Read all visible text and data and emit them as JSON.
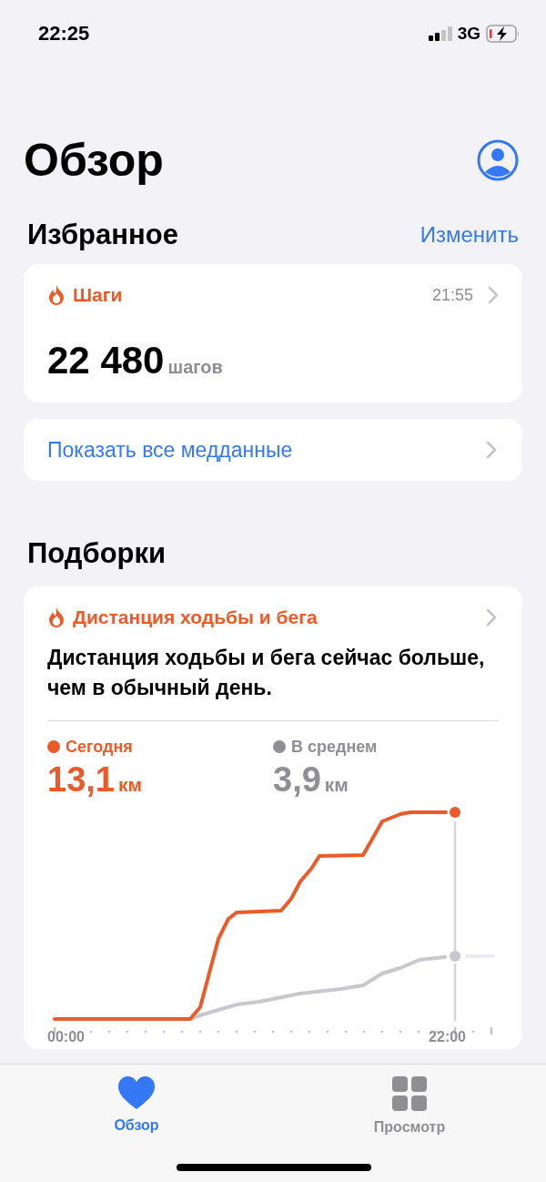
{
  "status_bar": {
    "time": "22:25",
    "network": "3G"
  },
  "header": {
    "title": "Обзор"
  },
  "favorites": {
    "title": "Избранное",
    "edit": "Изменить",
    "cards": [
      {
        "title": "Шаги",
        "time": "21:55",
        "value": "22 480",
        "unit": "шагов"
      }
    ],
    "show_all": "Показать все медданные"
  },
  "highlights": {
    "title": "Подборки",
    "cards": [
      {
        "title": "Дистанция ходьбы и бега",
        "text": "Дистанция ходьбы и бега сейчас больше, чем в обычный день.",
        "legend": [
          {
            "label": "Сегодня",
            "value": "13,1",
            "unit": "км",
            "color": "#eb5b2a"
          },
          {
            "label": "В среднем",
            "value": "3,9",
            "unit": "км",
            "color": "#8e8e93"
          }
        ],
        "x_labels": [
          "00:00",
          "22:00"
        ]
      }
    ]
  },
  "tabs": [
    {
      "label": "Обзор",
      "selected": true
    },
    {
      "label": "Просмотр",
      "selected": false
    }
  ]
}
